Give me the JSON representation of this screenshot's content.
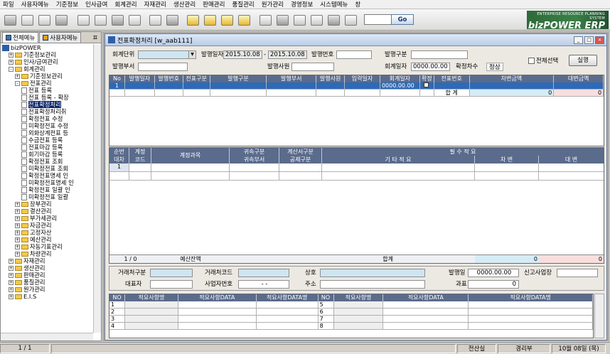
{
  "menubar": [
    "파일",
    "사용자메뉴",
    "기준정보",
    "인사급여",
    "회계관리",
    "자재관리",
    "생산관리",
    "판매관리",
    "품질관리",
    "원가관리",
    "경영정보",
    "시스템메뉴",
    "창"
  ],
  "toolbar": {
    "search_button": "Go",
    "icons": [
      "new-doc-icon",
      "new-icon",
      "view-icon",
      "print-preview-icon",
      "save-icon",
      "delete-icon",
      "print-icon",
      "open-icon",
      "copy-icon",
      "paste-icon",
      "first-icon",
      "prev-icon",
      "next-icon",
      "last-icon",
      "excel-icon",
      "tools-icon",
      "settings-icon",
      "help-icon",
      "mail-icon",
      "exit-icon"
    ]
  },
  "logo": {
    "line1": "ENTERPRISE RESOURCE PLANNING SYSTEM",
    "line2": "bizPOWER ERP"
  },
  "sidebar": {
    "tab1": "전체메뉴",
    "tab2": "사용자메뉴",
    "pin": "ㅍ",
    "tree": [
      {
        "level": 0,
        "icon": "bz",
        "text": "bizPOWER"
      },
      {
        "level": 1,
        "exp": "+",
        "icon": "fd",
        "text": "기준정보관리"
      },
      {
        "level": 1,
        "exp": "+",
        "icon": "fd",
        "text": "인사/급여관리"
      },
      {
        "level": 1,
        "exp": "-",
        "icon": "fd",
        "text": "회계관리"
      },
      {
        "level": 2,
        "exp": "+",
        "icon": "fd",
        "text": "기준정보관리"
      },
      {
        "level": 2,
        "exp": "-",
        "icon": "fd",
        "text": "전표관리"
      },
      {
        "level": 3,
        "icon": "dc",
        "text": "전표 등록"
      },
      {
        "level": 3,
        "icon": "dc",
        "text": "전표 등록 - 확장"
      },
      {
        "level": 3,
        "icon": "dc",
        "text": "전표확정처리",
        "sel": true
      },
      {
        "level": 3,
        "icon": "dc",
        "text": "전표확정처리취"
      },
      {
        "level": 3,
        "icon": "dc",
        "text": "확정전표 수정"
      },
      {
        "level": 3,
        "icon": "dc",
        "text": "미확정전표 수정"
      },
      {
        "level": 3,
        "icon": "dc",
        "text": "외화상계전표 등"
      },
      {
        "level": 3,
        "icon": "dc",
        "text": "수금전표 등록"
      },
      {
        "level": 3,
        "icon": "dc",
        "text": "전표마감 등록"
      },
      {
        "level": 3,
        "icon": "dc",
        "text": "회기마감 등록"
      },
      {
        "level": 3,
        "icon": "dc",
        "text": "확정전표 조회"
      },
      {
        "level": 3,
        "icon": "dc",
        "text": "미확정전표 조회"
      },
      {
        "level": 3,
        "icon": "dc",
        "text": "확정전표명세 인"
      },
      {
        "level": 3,
        "icon": "dc",
        "text": "미확정전표명세 인"
      },
      {
        "level": 3,
        "icon": "dc",
        "text": "확정전표 일괄 인"
      },
      {
        "level": 3,
        "icon": "dc",
        "text": "미확정전표 일괄"
      },
      {
        "level": 2,
        "exp": "+",
        "icon": "fd",
        "text": "장부관리"
      },
      {
        "level": 2,
        "exp": "+",
        "icon": "fd",
        "text": "결산관리"
      },
      {
        "level": 2,
        "exp": "+",
        "icon": "fd",
        "text": "부가세관리"
      },
      {
        "level": 2,
        "exp": "+",
        "icon": "fd",
        "text": "자금관리"
      },
      {
        "level": 2,
        "exp": "+",
        "icon": "fd",
        "text": "고정자산"
      },
      {
        "level": 2,
        "exp": "+",
        "icon": "fd",
        "text": "예산관리"
      },
      {
        "level": 2,
        "exp": "+",
        "icon": "fd",
        "text": "자동기표관리"
      },
      {
        "level": 2,
        "exp": "+",
        "icon": "fd",
        "text": "차량관리"
      },
      {
        "level": 1,
        "exp": "+",
        "icon": "fd",
        "text": "자재관리"
      },
      {
        "level": 1,
        "exp": "+",
        "icon": "fd",
        "text": "생산관리"
      },
      {
        "level": 1,
        "exp": "+",
        "icon": "fd",
        "text": "판매관리"
      },
      {
        "level": 1,
        "exp": "+",
        "icon": "fd",
        "text": "품질관리"
      },
      {
        "level": 1,
        "exp": "+",
        "icon": "fd",
        "text": "원가관리"
      },
      {
        "level": 1,
        "exp": "+",
        "icon": "fd",
        "text": "E.I.S"
      }
    ]
  },
  "window": {
    "title": "전표확정처리 [w_aab111]",
    "min": "_",
    "max": "□",
    "close": "×"
  },
  "form": {
    "unit_label": "회계단위",
    "issue_date_label": "발행일자",
    "date_from": "2015.10.08",
    "date_sep": "-",
    "date_to": "2015.10.08",
    "issue_no_label": "발행번호",
    "issue_type_label": "발행구분",
    "issue_dept_label": "발행부서",
    "issuer_label": "발행사원",
    "acct_date_label": "회계일자",
    "acct_date": "0000.00.00",
    "confirm_no_label": "확정차수",
    "confirm_status": "정상",
    "select_all": "전체선택",
    "run": "실행"
  },
  "grid1": {
    "headers": [
      "No",
      "발행일자",
      "발행번호",
      "전표구분",
      "발행구분",
      "발행부서",
      "발행사원",
      "입력일자",
      "회계일자",
      "확정",
      "전표번호",
      "차변금액",
      "대변금액"
    ],
    "row": [
      "1",
      "",
      "",
      "",
      "",
      "",
      "",
      "",
      "0000.00.00",
      "",
      "",
      "",
      ""
    ],
    "total_label": "합  계",
    "debit_total": "0",
    "credit_total": "0"
  },
  "grid2": {
    "h_seq": "순번",
    "h_code": "계정",
    "h_acct": "계정과목",
    "h_attr": "귀속구분",
    "h_calc": "계산서구분",
    "h_req": "필    수    적    요",
    "h_seq2": "대차",
    "h_code2": "코드",
    "h_attr2": "귀속부서",
    "h_tax2": "공제구분",
    "h_etc": "기    타    적    요",
    "h_dr": "차    변",
    "h_cr": "대    변",
    "row_no": "1",
    "footer_pos": "1 / 0",
    "budget_label": "예산잔액",
    "total_label": "합계",
    "debit_total": "0",
    "credit_total": "0"
  },
  "detail": {
    "cust_type": "거래처구분",
    "cust_code": "거래처코드",
    "company": "상호",
    "issue_day": "발행일",
    "issue_day_val": "0000.00.00",
    "new_site": "신고사업장",
    "ceo": "대표자",
    "biz_no": "사업자번호",
    "biz_no_val": "- -",
    "address": "주소",
    "tax_base": "과표",
    "tax_base_val": "0"
  },
  "grid3": {
    "headers": [
      "NO",
      "적요사항명",
      "적요사항DATA",
      "적요사항DATA명",
      "NO",
      "적요사항명",
      "적요사항DATA",
      "적요사항DATA명"
    ],
    "left_rows": [
      "1",
      "2",
      "3",
      "4"
    ],
    "right_rows": [
      "5",
      "6",
      "7",
      "8"
    ]
  },
  "status": {
    "page": "1 / 1",
    "dept": "전산실",
    "team": "경리부",
    "date": "10월 08일 (목)"
  }
}
